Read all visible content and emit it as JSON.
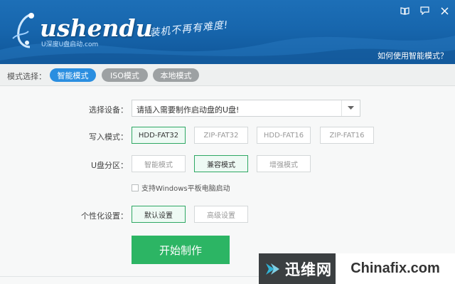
{
  "header": {
    "logo_text": "ushendu",
    "logo_sub": "U深度U盘启动.com",
    "slogan": "装机不再有难度!",
    "help_link": "如何使用智能模式？",
    "icons": [
      "book-icon",
      "message-icon",
      "close-icon"
    ]
  },
  "modebar": {
    "label": "模式选择：",
    "tabs": [
      {
        "label": "智能模式",
        "active": true
      },
      {
        "label": "ISO模式",
        "active": false
      },
      {
        "label": "本地模式",
        "active": false
      }
    ]
  },
  "form": {
    "device_label": "选择设备：",
    "device_value": "请插入需要制作启动盘的U盘!",
    "write_label": "写入模式：",
    "write_options": [
      "HDD-FAT32",
      "ZIP-FAT32",
      "HDD-FAT16",
      "ZIP-FAT16"
    ],
    "write_selected": "HDD-FAT32",
    "partition_label": "U盘分区：",
    "partition_options": [
      "智能模式",
      "兼容模式",
      "增强模式"
    ],
    "partition_selected": "兼容模式",
    "checkbox_label": "支持Windows平板电脑启动",
    "checkbox_checked": false,
    "personal_label": "个性化设置：",
    "personal_options": [
      "默认设置",
      "高级设置"
    ],
    "personal_selected": "默认设置",
    "start_button": "开始制作"
  },
  "watermark": {
    "left_text": "迅维网",
    "right_text": "Chinafix.com"
  },
  "colors": {
    "header_blue": "#1766ad",
    "active_tab": "#2a8ee0",
    "start_green": "#2cb564",
    "selected_border": "#2fa864"
  }
}
